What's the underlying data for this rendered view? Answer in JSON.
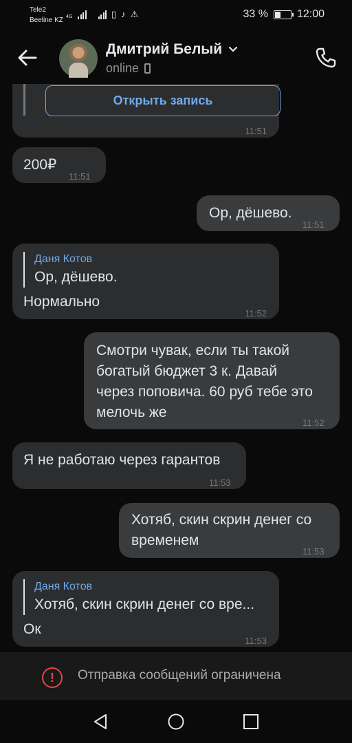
{
  "statusbar": {
    "carrier1": "Tele2",
    "carrier2": "Beeline KZ",
    "network": "4G",
    "battery_label": "33 %",
    "battery_level": 0.33,
    "time": "12:00"
  },
  "header": {
    "name": "Дмитрий Белый",
    "status": "online"
  },
  "messages": [
    {
      "id": "m0",
      "type": "in",
      "button": "Открыть запись",
      "time": "11:51"
    },
    {
      "id": "m1",
      "type": "in",
      "text": "200₽",
      "time": "11:51"
    },
    {
      "id": "m2",
      "type": "out",
      "text": "Ор, дёшево.",
      "time": "11:51"
    },
    {
      "id": "m3",
      "type": "in",
      "reply_author": "Даня Котов",
      "reply_text": "Ор, дёшево.",
      "text": "Нормально",
      "time": "11:52"
    },
    {
      "id": "m4",
      "type": "out",
      "lines": [
        "Смотри чувак, если ты такой",
        "богатый бюджет 3 к. Давай",
        "через поповича. 60 руб тебе это",
        "мелочь же"
      ],
      "time": "11:52"
    },
    {
      "id": "m5",
      "type": "in",
      "text": "Я не работаю через гарантов",
      "time": "11:53"
    },
    {
      "id": "m6",
      "type": "out",
      "lines": [
        "Хотяб, скин скрин денег со",
        "временем"
      ],
      "time": "11:53"
    },
    {
      "id": "m7",
      "type": "in",
      "reply_author": "Даня Котов",
      "reply_text": "Хотяб, скин скрин денег со вре...",
      "text": "Ок",
      "time": "11:53"
    }
  ],
  "footer": {
    "restricted_text": "Отправка сообщений ограничена"
  },
  "colors": {
    "accent": "#71aaeb",
    "bubble_in": "#2c2d2e",
    "bubble_out": "#3a3b3c",
    "warning": "#e64646"
  },
  "icons": [
    "back-arrow-icon",
    "chevron-down-icon",
    "phone-icon",
    "mobile-icon",
    "warning-icon",
    "nav-back-icon",
    "nav-home-icon",
    "nav-recents-icon"
  ]
}
